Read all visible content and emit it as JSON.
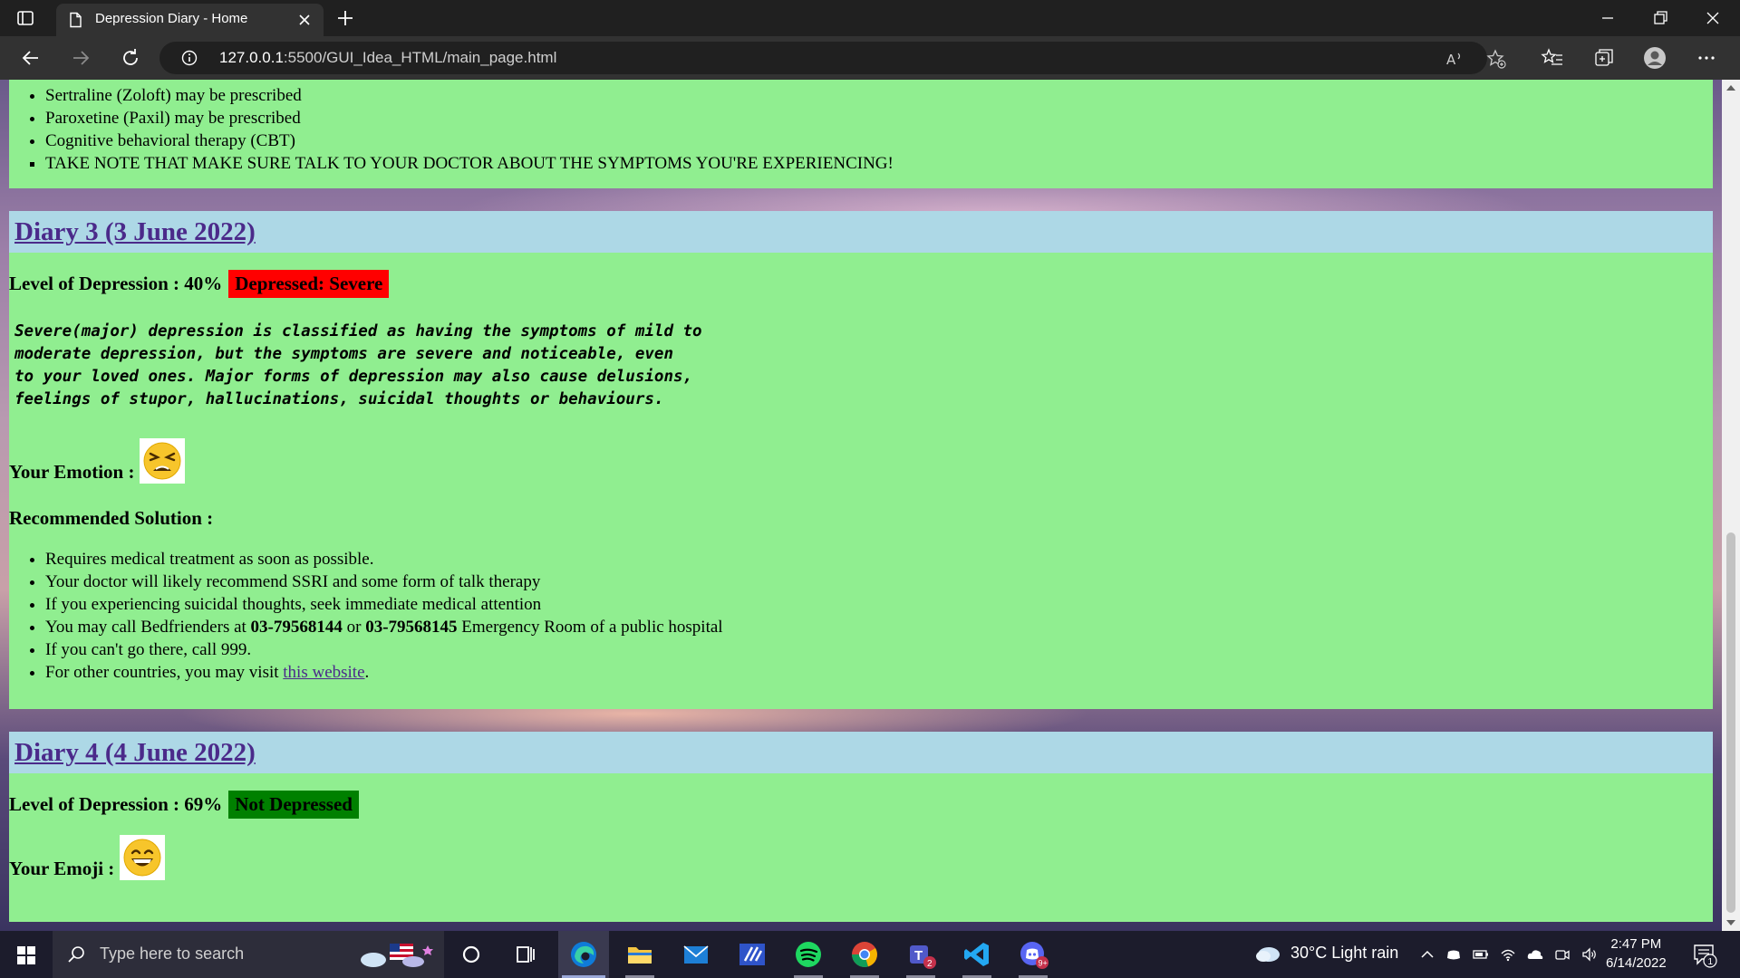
{
  "browser": {
    "tab_title": "Depression Diary - Home",
    "url_host": "127.0.0.1",
    "url_rest": ":5500/GUI_Idea_HTML/main_page.html"
  },
  "diary2_tail": {
    "solutions": [
      "Sertraline (Zoloft) may be prescribed",
      "Paroxetine (Paxil) may be prescribed",
      "Cognitive behavioral therapy (CBT)",
      "TAKE NOTE THAT MAKE SURE TALK TO YOUR DOCTOR ABOUT THE SYMPTOMS YOU'RE EXPERIENCING!"
    ]
  },
  "diary3": {
    "title": "Diary 3 (3 June 2022)",
    "level_label": "Level of Depression : 40%",
    "badge": "Depressed: Severe",
    "badge_color": "#ff0000",
    "description_lines": [
      "Severe(major) depression is classified as having the symptoms of mild to",
      "moderate depression, but the symptoms are severe and noticeable, even",
      "to your loved ones. Major forms of depression may also cause delusions,",
      "feelings of stupor, hallucinations, suicidal thoughts or behaviours."
    ],
    "emotion_label": "Your Emotion :",
    "emotion_icon": "tired-face-emoji",
    "recommended_label": "Recommended Solution :",
    "solutions": [
      "Requires medical treatment as soon as possible.",
      "Your doctor will likely recommend SSRI and some form of talk therapy",
      "If you experiencing suicidal thoughts, seek immediate medical attention"
    ],
    "call_prefix": "You may call Bedfrienders at ",
    "phone1": "03-79568144",
    "call_or": " or ",
    "phone2": "03-79568145",
    "call_suffix": " Emergency Room of a public hospital",
    "call999": "If you can't go there, call 999.",
    "visit_prefix": "For other countries, you may visit ",
    "visit_link": "this website",
    "visit_suffix": "."
  },
  "diary4": {
    "title": "Diary 4 (4 June 2022)",
    "level_label": "Level of Depression : 69%",
    "badge": "Not Depressed",
    "badge_color": "#008000",
    "emoji_label": "Your Emoji :",
    "emoji_icon": "grinning-face-emoji"
  },
  "taskbar": {
    "search_placeholder": "Type here to search",
    "weather": "30°C  Light rain",
    "time": "2:47 PM",
    "date": "6/14/2022",
    "teams_badge": "2",
    "discord_badge": "9+",
    "notification_count": "1"
  }
}
